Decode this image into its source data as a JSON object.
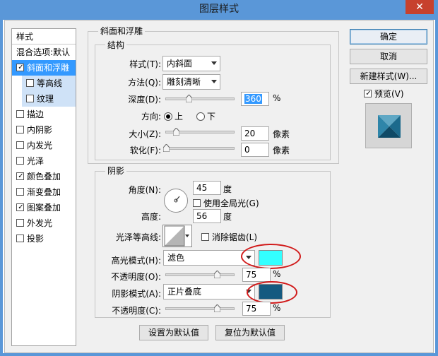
{
  "window": {
    "title": "图层样式",
    "close_glyph": "✕"
  },
  "sidebar": {
    "header": "样式",
    "items": [
      {
        "label": "混合选项:默认",
        "checkbox": false,
        "checked": false,
        "selected": false,
        "sub": false
      },
      {
        "label": "斜面和浮雕",
        "checkbox": true,
        "checked": true,
        "selected": true,
        "sub": false
      },
      {
        "label": "等高线",
        "checkbox": true,
        "checked": false,
        "selected": false,
        "sub": true
      },
      {
        "label": "纹理",
        "checkbox": true,
        "checked": false,
        "selected": false,
        "sub": true
      },
      {
        "label": "描边",
        "checkbox": true,
        "checked": false,
        "selected": false,
        "sub": false
      },
      {
        "label": "内阴影",
        "checkbox": true,
        "checked": false,
        "selected": false,
        "sub": false
      },
      {
        "label": "内发光",
        "checkbox": true,
        "checked": false,
        "selected": false,
        "sub": false
      },
      {
        "label": "光泽",
        "checkbox": true,
        "checked": false,
        "selected": false,
        "sub": false
      },
      {
        "label": "颜色叠加",
        "checkbox": true,
        "checked": true,
        "selected": false,
        "sub": false
      },
      {
        "label": "渐变叠加",
        "checkbox": true,
        "checked": false,
        "selected": false,
        "sub": false
      },
      {
        "label": "图案叠加",
        "checkbox": true,
        "checked": true,
        "selected": false,
        "sub": false
      },
      {
        "label": "外发光",
        "checkbox": true,
        "checked": false,
        "selected": false,
        "sub": false
      },
      {
        "label": "投影",
        "checkbox": true,
        "checked": false,
        "selected": false,
        "sub": false
      }
    ]
  },
  "bevel": {
    "group_title": "斜面和浮雕",
    "structure_title": "结构",
    "style_label": "样式(T):",
    "style_value": "内斜面",
    "technique_label": "方法(Q):",
    "technique_value": "雕刻清晰",
    "depth_label": "深度(D):",
    "depth_value": "360",
    "depth_unit": "%",
    "direction_label": "方向:",
    "direction_up": "上",
    "direction_down": "下",
    "size_label": "大小(Z):",
    "size_value": "20",
    "size_unit": "像素",
    "soften_label": "软化(F):",
    "soften_value": "0",
    "soften_unit": "像素"
  },
  "shading": {
    "group_title": "阴影",
    "angle_label": "角度(N):",
    "angle_value": "45",
    "angle_unit": "度",
    "global_light_label": "使用全局光(G)",
    "altitude_label": "高度:",
    "altitude_value": "56",
    "altitude_unit": "度",
    "gloss_label": "光泽等高线:",
    "antialias_label": "消除锯齿(L)",
    "highlight_label": "高光模式(H):",
    "highlight_mode": "滤色",
    "highlight_color": "#33ffff",
    "highlight_opacity_label": "不透明度(O):",
    "highlight_opacity": "75",
    "highlight_opacity_unit": "%",
    "shadow_label": "阴影模式(A):",
    "shadow_mode": "正片叠底",
    "shadow_color": "#155a80",
    "shadow_opacity_label": "不透明度(C):",
    "shadow_opacity": "75",
    "shadow_opacity_unit": "%"
  },
  "footer": {
    "make_default": "设置为默认值",
    "reset_default": "复位为默认值"
  },
  "actions": {
    "ok": "确定",
    "cancel": "取消",
    "new_style": "新建样式(W)...",
    "preview": "预览(V)"
  }
}
